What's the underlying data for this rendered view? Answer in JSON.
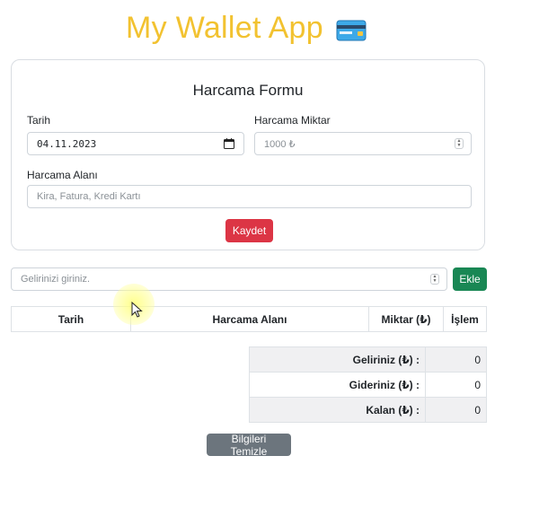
{
  "app": {
    "title": "My Wallet App",
    "accent": "#f2c230"
  },
  "form": {
    "title": "Harcama Formu",
    "date_label": "Tarih",
    "date_value": "04.11.2023",
    "amount_label": "Harcama Miktar",
    "amount_placeholder": "1000 ₺",
    "area_label": "Harcama Alanı",
    "area_placeholder": "Kira, Fatura, Kredi Kartı",
    "save_label": "Kaydet"
  },
  "income": {
    "placeholder": "Gelirinizi giriniz.",
    "add_label": "Ekle"
  },
  "table": {
    "headers": [
      "Tarih",
      "Harcama Alanı",
      "Miktar (₺)",
      "İşlem"
    ]
  },
  "summary": {
    "rows": [
      {
        "label": "Geliriniz (₺) :",
        "value": "0"
      },
      {
        "label": "Gideriniz (₺) :",
        "value": "0"
      },
      {
        "label": "Kalan (₺) :",
        "value": "0"
      }
    ]
  },
  "clear_label": "Bilgileri Temizle",
  "colors": {
    "danger": "#dc3545",
    "success": "#198754",
    "secondary": "#6c757d"
  }
}
